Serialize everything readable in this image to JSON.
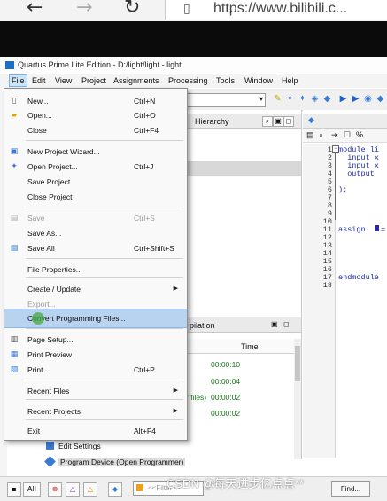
{
  "browser": {
    "back_glyph": "←",
    "forward_glyph": "→",
    "refresh_glyph": "↻",
    "address": "https://www.bilibili.c..."
  },
  "window": {
    "title": "Quartus Prime Lite Edition - D:/light/light - light"
  },
  "menu_bar": {
    "items": [
      "File",
      "Edit",
      "View",
      "Project",
      "Assignments",
      "Processing",
      "Tools",
      "Window",
      "Help"
    ]
  },
  "navigator": {
    "tab_label": "Hierarchy"
  },
  "file_menu": {
    "items": [
      {
        "label": "New...",
        "shortcut": "Ctrl+N",
        "icon": "new-file-icon"
      },
      {
        "label": "Open...",
        "shortcut": "Ctrl+O",
        "icon": "open-folder-icon"
      },
      {
        "label": "Close",
        "shortcut": "Ctrl+F4"
      },
      {
        "label": "New Project Wizard...",
        "icon": "wizard-icon"
      },
      {
        "label": "Open Project...",
        "shortcut": "Ctrl+J",
        "icon": "open-project-icon"
      },
      {
        "label": "Save Project"
      },
      {
        "label": "Close Project"
      },
      {
        "label": "Save",
        "shortcut": "Ctrl+S",
        "disabled": true,
        "icon": "save-icon"
      },
      {
        "label": "Save As..."
      },
      {
        "label": "Save All",
        "shortcut": "Ctrl+Shift+S",
        "icon": "save-all-icon"
      },
      {
        "label": "File Properties..."
      },
      {
        "label": "Create / Update"
      },
      {
        "label": "Export...",
        "disabled": true
      },
      {
        "label": "Convert Programming Files..."
      },
      {
        "label": "Page Setup...",
        "icon": "page-setup-icon"
      },
      {
        "label": "Print Preview",
        "icon": "print-preview-icon"
      },
      {
        "label": "Print...",
        "shortcut": "Ctrl+P",
        "icon": "print-icon"
      },
      {
        "label": "Recent Files"
      },
      {
        "label": "Recent Projects"
      },
      {
        "label": "Exit",
        "shortcut": "Alt+F4"
      }
    ]
  },
  "tasks": {
    "tab_label": "pilation",
    "time_header": "Time",
    "times": [
      "00:00:10",
      "00:00:04",
      "00:00:02",
      "00:00:02"
    ],
    "files_fragment": "r files)",
    "rows": [
      "Edit Settings",
      "Program Device (Open Programmer)"
    ]
  },
  "editor": {
    "line_numbers": [
      "1",
      "2",
      "3",
      "4",
      "5",
      "6",
      "7",
      "8",
      "9",
      "10",
      "11",
      "12",
      "13",
      "14",
      "15",
      "16",
      "17",
      "18"
    ],
    "lines": {
      "l1": "module li",
      "l2": "  input x",
      "l3": "  input x",
      "l4": "  output",
      "l6": ");",
      "l11": "assign ",
      "l11b": "=",
      "l17": "endmodule"
    }
  },
  "status": {
    "all_label": "All",
    "filter_placeholder": "<<Filter>>",
    "find_label": "Find..."
  },
  "watermark": "CSDN @每天进步亿点点**"
}
